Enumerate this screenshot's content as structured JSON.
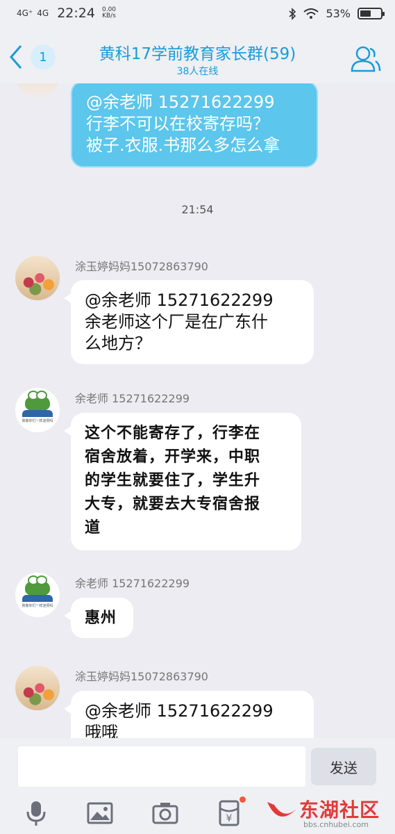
{
  "status_bar": {
    "network1": "4G⁺",
    "network2": "4G",
    "time": "22:24",
    "speed_value": "0.00",
    "speed_unit": "KB/s",
    "battery": "53%",
    "battery_level": 0.53
  },
  "header": {
    "unread_count": "1",
    "title": "黄科17学前教育家长群(59)",
    "subtitle": "38人在线"
  },
  "messages": [
    {
      "sender": "",
      "lines": [
        "@余老师 15271622299",
        "行李不可以在校寄存吗？",
        "被子.衣服.书那么多怎么拿"
      ],
      "style": "blue"
    },
    {
      "sender": "涂玉婷妈妈15072863790",
      "lines": [
        "@余老师 15271622299",
        "余老师这个厂是在广东什",
        "么地方？"
      ]
    },
    {
      "sender": "余老师 15271622299",
      "lines": [
        "这个不能寄存了，行李在",
        "宿舍放着，开学来，中职",
        "的学生就要住了，学生升",
        "大专，就要去大专宿舍报",
        "道"
      ],
      "style": "handwriting"
    },
    {
      "sender": "余老师 15271622299",
      "lines": [
        "惠州"
      ],
      "style": "handwriting"
    },
    {
      "sender": "涂玉婷妈妈15072863790",
      "lines": [
        "@余老师 15271622299",
        "哦哦"
      ]
    }
  ],
  "timestamp": "21:54",
  "avatar_caption": "我像你们一样迷惘吗",
  "input": {
    "placeholder": "",
    "send_label": "发送"
  },
  "toolbar": {
    "icons": [
      "microphone-icon",
      "image-icon",
      "camera-icon",
      "red-packet-icon",
      "more-icon"
    ]
  },
  "watermark": {
    "text": "东湖社区",
    "sub": "bbs.cnhubei.com"
  },
  "colors": {
    "accent": "#1a9bd8",
    "bubble_blue": "#5cc6ec",
    "background": "#ececf2"
  }
}
